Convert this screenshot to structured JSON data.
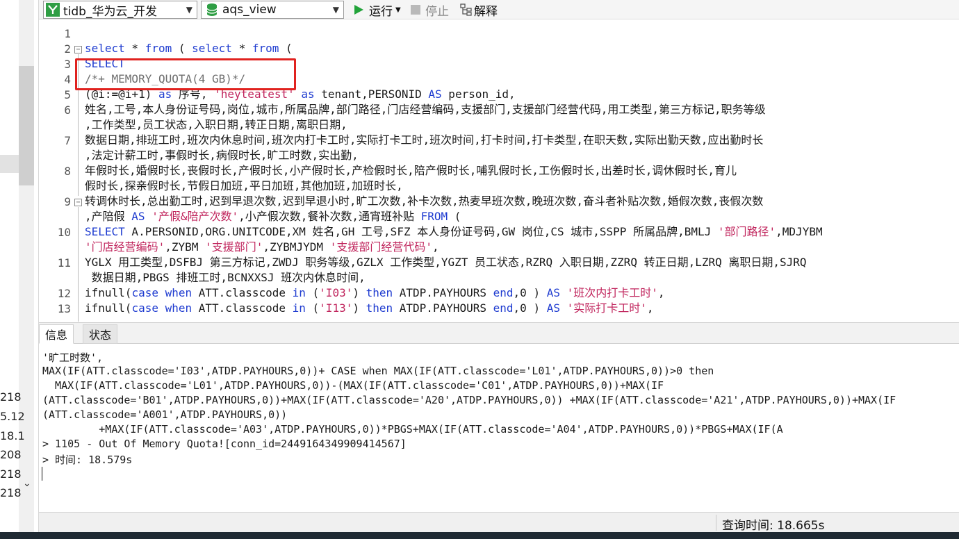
{
  "left_panel": {
    "numbers": [
      "218",
      "5.12",
      "18.1",
      "208",
      "218",
      "218"
    ],
    "chevron_icon": "chevron-down-icon"
  },
  "toolbar": {
    "connection": {
      "value": "tidb_华为云_开发",
      "icon": "connection-icon"
    },
    "database": {
      "value": "aqs_view",
      "icon": "database-icon"
    },
    "run_label": "运行",
    "run_icon": "play-icon",
    "stop_label": "停止",
    "stop_icon": "stop-icon",
    "explain_label": "解释",
    "explain_icon": "explain-icon"
  },
  "editor": {
    "line_numbers": [
      "1",
      "2",
      "3",
      "4",
      "5",
      "6",
      "7",
      "8",
      "9",
      "10",
      "11",
      "12",
      "13"
    ],
    "lines": {
      "l2": {
        "k1": "select",
        "t1": " * ",
        "k2": "from",
        "t2": " ( ",
        "k3": "select",
        "t3": " * ",
        "k4": "from",
        "t4": " ("
      },
      "l3": {
        "k1": "SELECT"
      },
      "l4": {
        "c1": "/*+ MEMORY_QUOTA(4 GB)*/"
      },
      "l5": {
        "t1": "(@i:=@i+1) ",
        "k1": "as",
        "t2": " 序号, ",
        "s1": "'heyteatest'",
        "t3": " ",
        "k2": "as",
        "t4": " tenant,PERSONID ",
        "k3": "AS",
        "t5": " person_id,"
      },
      "l6a": "姓名,工号,本人身份证号码,岗位,城市,所属品牌,部门路径,门店经营编码,支援部门,支援部门经营代码,用工类型,第三方标记,职务等级",
      "l6b": ",工作类型,员工状态,入职日期,转正日期,离职日期,",
      "l7a": "数据日期,排班工时,班次内休息时间,班次内打卡工时,实际打卡工时,班次时间,打卡时间,打卡类型,在职天数,实际出勤天数,应出勤时长",
      "l7b": ",法定计薪工时,事假时长,病假时长,旷工时数,实出勤,",
      "l8a": "年假时长,婚假时长,丧假时长,产假时长,小产假时长,产检假时长,陪产假时长,哺乳假时长,工伤假时长,出差时长,调休假时长,育儿",
      "l8b": "假时长,探亲假时长,节假日加班,平日加班,其他加班,加班时长,",
      "l9a": "转调休时长,总出勤工时,迟到早退次数,迟到早退小时,旷工次数,补卡次数,热麦早班次数,晚班次数,奋斗者补贴次数,婚假次数,丧假次数",
      "l9b": {
        "t1": ",产陪假 ",
        "k1": "AS",
        "t2": " ",
        "s1": "'产假&陪产次数'",
        "t3": ",小产假次数,餐补次数,通宵班补贴 ",
        "k2": "FROM",
        "t4": " ("
      },
      "l10a": {
        "k1": "SELECT",
        "t1": " A.PERSONID,ORG.UNITCODE,XM 姓名,GH 工号,SFZ 本人身份证号码,GW 岗位,CS 城市,SSPP 所属品牌,BMLJ ",
        "s1": "'部门路径'",
        "t2": ",MDJYBM"
      },
      "l10b": {
        "s1": "'门店经营编码'",
        "t1": ",ZYBM ",
        "s2": "'支援部门'",
        "t2": ",ZYBMJYDM ",
        "s3": "'支援部门经营代码'",
        "t3": ","
      },
      "l11a": "YGLX 用工类型,DSFBJ 第三方标记,ZWDJ 职务等级,GZLX 工作类型,YGZT 员工状态,RZRQ 入职日期,ZZRQ 转正日期,LZRQ 离职日期,SJRQ",
      "l11b": " 数据日期,PBGS 排班工时,BCNXXSJ 班次内休息时间,",
      "l12": {
        "t1": "ifnull(",
        "k1": "case",
        "t2": " ",
        "k2": "when",
        "t3": " ATT.classcode ",
        "k3": "in",
        "t4": " (",
        "s1": "'I03'",
        "t5": ") ",
        "k4": "then",
        "t6": " ATDP.PAYHOURS ",
        "k5": "end",
        "t7": ",0 ) ",
        "k6": "AS",
        "t8": " ",
        "s2": "'班次内打卡工时'",
        "t9": ","
      },
      "l13": {
        "t1": "ifnull(",
        "k1": "case",
        "t2": " ",
        "k2": "when",
        "t3": " ATT.classcode ",
        "k3": "in",
        "t4": " (",
        "s1": "'I13'",
        "t5": ") ",
        "k4": "then",
        "t6": " ATDP.PAYHOURS ",
        "k5": "end",
        "t7": ",0 ) ",
        "k6": "AS",
        "t8": " ",
        "s2": "'实际打卡工时'",
        "t9": ","
      }
    }
  },
  "tabs": [
    {
      "label": "信息",
      "active": true
    },
    {
      "label": "状态",
      "active": false
    }
  ],
  "output": {
    "lines": [
      "'旷工时数',",
      "MAX(IF(ATT.classcode='I03',ATDP.PAYHOURS,0))+ CASE when MAX(IF(ATT.classcode='L01',ATDP.PAYHOURS,0))>0 then",
      "  MAX(IF(ATT.classcode='L01',ATDP.PAYHOURS,0))-(MAX(IF(ATT.classcode='C01',ATDP.PAYHOURS,0))+MAX(IF",
      "(ATT.classcode='B01',ATDP.PAYHOURS,0))+MAX(IF(ATT.classcode='A20',ATDP.PAYHOURS,0)) +MAX(IF(ATT.classcode='A21',ATDP.PAYHOURS,0))+MAX(IF",
      "(ATT.classcode='A001',ATDP.PAYHOURS,0))",
      "         +MAX(IF(ATT.classcode='A03',ATDP.PAYHOURS,0))*PBGS+MAX(IF(ATT.classcode='A04',ATDP.PAYHOURS,0))*PBGS+MAX(IF(A",
      "> 1105 - Out Of Memory Quota![conn_id=2449164349909414567]",
      "> 时间: 18.579s"
    ]
  },
  "status_bar": {
    "query_time": "查询时间: 18.665s"
  },
  "colors": {
    "keyword": "#1f3cd0",
    "string": "#c0245c",
    "comment": "#6e6e6e",
    "highlight_box": "#e0221f",
    "run_icon": "#22a33a"
  }
}
